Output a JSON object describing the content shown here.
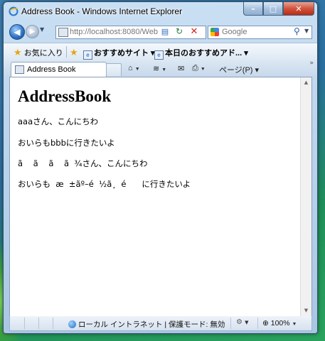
{
  "window": {
    "title": "Address Book - Windows Internet Explorer",
    "controls": {
      "minimize": "–",
      "maximize": "□",
      "close": "✕"
    }
  },
  "address_bar": {
    "url": "http://localhost:8080/Web",
    "refresh_icon": "refresh-icon",
    "stop_icon": "stop-icon"
  },
  "search": {
    "placeholder": "Google",
    "go_icon": "search-icon"
  },
  "favorites_bar": {
    "favorites_label": "お気に入り",
    "items": [
      {
        "label": "おすすめサイト ▾"
      },
      {
        "label": "本日のおすすめアド... ▾"
      }
    ]
  },
  "tabs": [
    {
      "label": "Address Book"
    }
  ],
  "command_bar": {
    "home": "⌂",
    "feeds": "≋",
    "mail": "✉",
    "print": "⎙",
    "page_label": "ページ(P) ▾",
    "overflow": "»"
  },
  "page": {
    "title": "AddressBook",
    "lines": [
      "aaaさん、こんにちわ",
      "おいらもbbbに行きたいよ",
      "ã    ã    ã    ã  ¾さん、こんにちわ",
      "おいらも  æ  ±ãº–é  ½ã¸  é      に行きたいよ"
    ]
  },
  "status_bar": {
    "zone": "ローカル イントラネット | 保護モード: 無効",
    "zoom": "100%"
  }
}
